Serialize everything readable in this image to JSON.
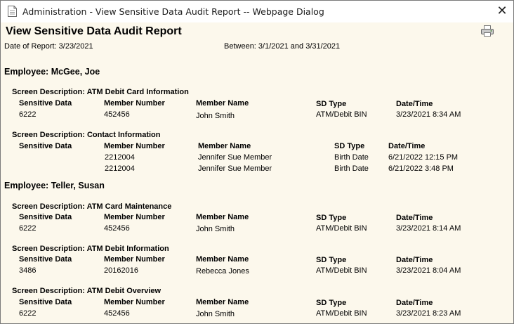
{
  "window": {
    "title": "Administration - View Sensitive Data Audit Report -- Webpage Dialog",
    "close_glyph": "✕"
  },
  "report": {
    "title": "View Sensitive Data Audit Report",
    "date_of_report": "Date of Report: 3/23/2021",
    "between": "Between: 3/1/2021 and 3/31/2021"
  },
  "columns": {
    "sensitive_data": "Sensitive Data",
    "member_number": "Member Number",
    "member_name": "Member Name",
    "sd_type": "SD Type",
    "date_time": "Date/Time"
  },
  "employees": [
    {
      "label": "Employee:",
      "name": "McGee, Joe",
      "screens": [
        {
          "description": "Screen Description: ATM Debit Card Information",
          "rows": [
            {
              "sensitive_data": "6222",
              "member_number": "452456",
              "member_name": "John Smith",
              "sd_type": "ATM/Debit BIN",
              "date_time": "3/23/2021 8:34 AM"
            }
          ]
        },
        {
          "description": "Screen Description: Contact Information",
          "rows": [
            {
              "sensitive_data": "",
              "member_number": "2212004",
              "member_name": "Jennifer Sue Member",
              "sd_type": "Birth Date",
              "date_time": "6/21/2022 12:15 PM"
            },
            {
              "sensitive_data": "",
              "member_number": "2212004",
              "member_name": "Jennifer Sue Member",
              "sd_type": "Birth Date",
              "date_time": "6/21/2022 3:48 PM"
            }
          ]
        }
      ]
    },
    {
      "label": "Employee:",
      "name": "Teller, Susan",
      "screens": [
        {
          "description": "Screen Description: ATM Card Maintenance",
          "rows": [
            {
              "sensitive_data": "6222",
              "member_number": "452456",
              "member_name": "John Smith",
              "sd_type": "ATM/Debit BIN",
              "date_time": "3/23/2021 8:14 AM"
            }
          ]
        },
        {
          "description": "Screen Description: ATM Debit Information",
          "rows": [
            {
              "sensitive_data": "3486",
              "member_number": "20162016",
              "member_name": "Rebecca Jones",
              "sd_type": "ATM/Debit BIN",
              "date_time": "3/23/2021 8:04 AM"
            }
          ]
        },
        {
          "description": "Screen Description: ATM Debit Overview",
          "rows": [
            {
              "sensitive_data": "6222",
              "member_number": "452456",
              "member_name": "John Smith",
              "sd_type": "ATM/Debit BIN",
              "date_time": "3/23/2021 8:23 AM"
            }
          ]
        }
      ]
    }
  ]
}
